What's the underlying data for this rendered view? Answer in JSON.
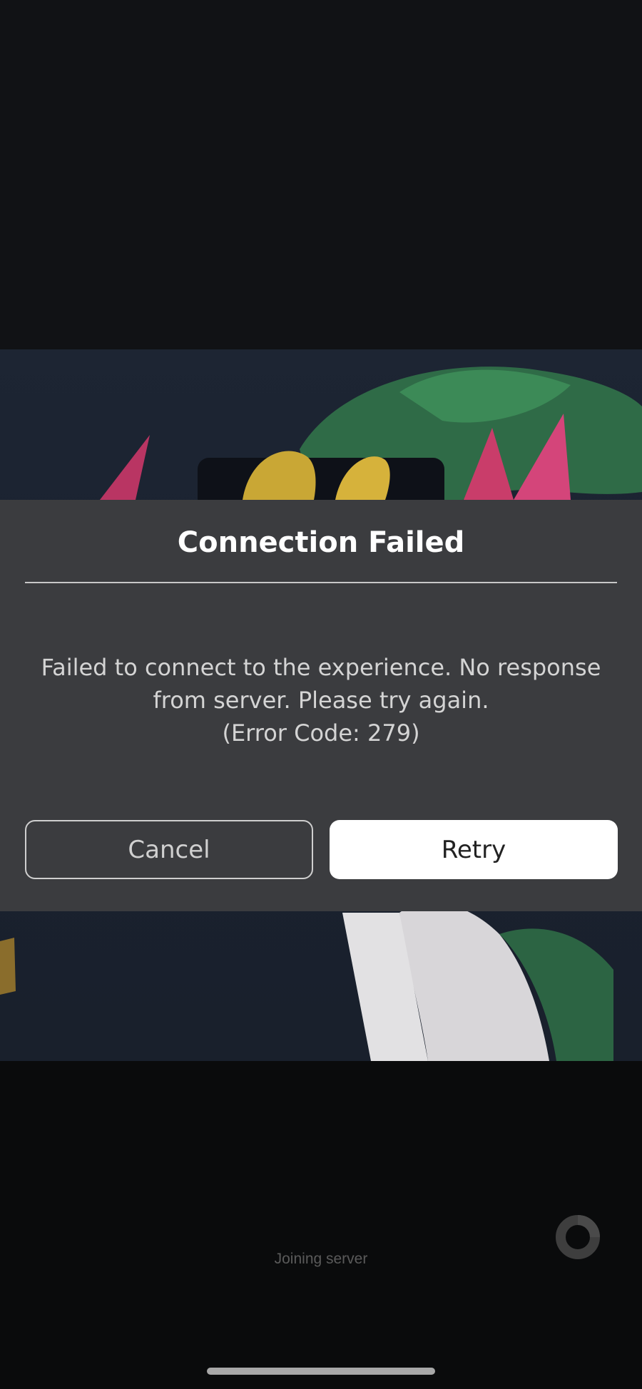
{
  "dialog": {
    "title": "Connection Failed",
    "message_lines": [
      "Failed to connect to the experience. No response",
      "from server. Please try again.",
      "(Error Code: 279)"
    ],
    "cancel_label": "Cancel",
    "retry_label": "Retry"
  },
  "loading": {
    "status_text": "Joining server"
  },
  "colors": {
    "background": "#111215",
    "dialog_background": "#3b3c3f",
    "retry_button": "#ffffff",
    "text_primary": "#ffffff"
  },
  "icons": [
    "loading-spinner-icon"
  ]
}
